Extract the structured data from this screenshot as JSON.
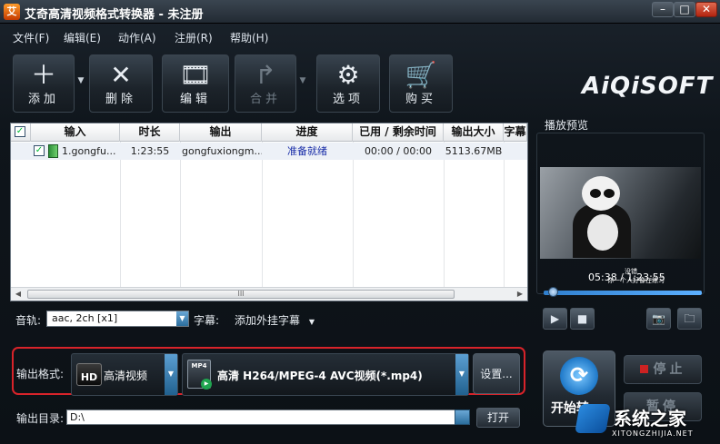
{
  "window": {
    "title": "艾奇高清视频格式转换器 - 未注册",
    "minimize": "–",
    "maximize": "□",
    "close": "✕"
  },
  "menu": [
    "文件(F)",
    "编辑(E)",
    "动作(A)",
    "注册(R)",
    "帮助(H)"
  ],
  "toolbar": {
    "add": {
      "label": "添加",
      "icon": "plus-icon"
    },
    "delete": {
      "label": "删除",
      "icon": "x-icon"
    },
    "edit": {
      "label": "编辑",
      "icon": "film-edit-icon"
    },
    "merge": {
      "label": "合并",
      "icon": "merge-arrow-icon",
      "disabled": true
    },
    "options": {
      "label": "选项",
      "icon": "gears-icon"
    },
    "buy": {
      "label": "购买",
      "icon": "cart-icon"
    }
  },
  "brand": "AiQiSOFT",
  "table": {
    "headers": [
      "输入",
      "时长",
      "输出",
      "进度",
      "已用 / 剩余时间",
      "输出大小",
      "字幕"
    ],
    "rows": [
      {
        "input": "1.gongfu...",
        "duration": "1:23:55",
        "output": "gongfuxiongm...",
        "progress": "准备就绪",
        "time": "00:00 / 00:00",
        "size": "5113.67MB",
        "checked": true
      }
    ],
    "scroll_grip": "III"
  },
  "audio": {
    "label": "音轨:",
    "value": "aac, 2ch [x1]"
  },
  "subtitle": {
    "label": "字幕:",
    "value": "添加外挂字幕"
  },
  "preview": {
    "title": "播放预览",
    "caption1": "没错",
    "caption2": "你一个人好像在练习",
    "time": "05:38 / 1:23:55",
    "seek_fraction": 0.06
  },
  "output": {
    "format_label": "输出格式:",
    "category": "高清视频",
    "category_icon": "HD",
    "format": "高清 H264/MPEG-4 AVC视频(*.mp4)",
    "format_icon": "MP4",
    "settings": "设置...",
    "dir_label": "输出目录:",
    "dir_value": "D:\\",
    "open": "打开"
  },
  "actions": {
    "start": "开始转",
    "stop": "停止",
    "pause": "暂停"
  },
  "watermark": {
    "text": "系统之家",
    "url": "XITONGZHIJIA.NET"
  },
  "colors": {
    "highlight_border": "#d8232a",
    "progress_text": "#1a2ea8"
  }
}
